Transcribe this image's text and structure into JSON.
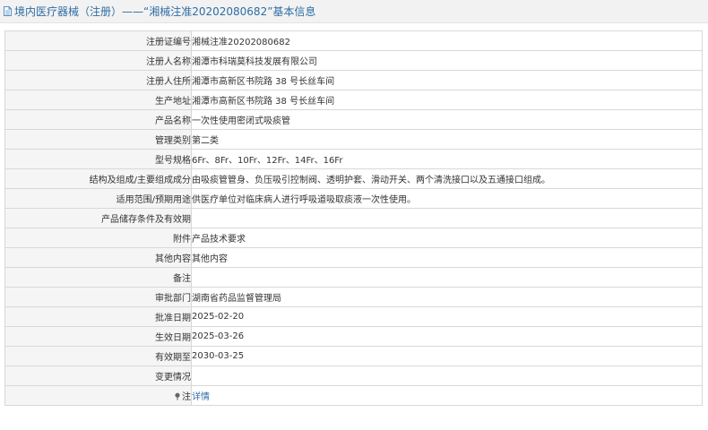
{
  "header": {
    "title": "境内医疗器械（注册）——“湘械注准20202080682”基本信息"
  },
  "rows": [
    {
      "label": "注册证编号",
      "value": "湘械注准20202080682"
    },
    {
      "label": "注册人名称",
      "value": "湘潭市科瑞莫科技发展有限公司"
    },
    {
      "label": "注册人住所",
      "value": "湘潭市高新区书院路 38 号长丝车间"
    },
    {
      "label": "生产地址",
      "value": "湘潭市高新区书院路 38 号长丝车间"
    },
    {
      "label": "产品名称",
      "value": "一次性使用密闭式吸痰管"
    },
    {
      "label": "管理类别",
      "value": "第二类"
    },
    {
      "label": "型号规格",
      "value": "6Fr、8Fr、10Fr、12Fr、14Fr、16Fr"
    },
    {
      "label": "结构及组成/主要组成成分",
      "value": "由吸痰管管身、负压吸引控制阀、透明护套、滑动开关、两个清洗接口以及五通接口组成。"
    },
    {
      "label": "适用范围/预期用途",
      "value": "供医疗单位对临床病人进行呼吸道吸取痰液一次性使用。"
    },
    {
      "label": "产品储存条件及有效期",
      "value": ""
    },
    {
      "label": "附件",
      "value": "产品技术要求"
    },
    {
      "label": "其他内容",
      "value": "其他内容"
    },
    {
      "label": "备注",
      "value": ""
    },
    {
      "label": "审批部门",
      "value": "湖南省药品监督管理局"
    },
    {
      "label": "批准日期",
      "value": "2025-02-20"
    },
    {
      "label": "生效日期",
      "value": "2025-03-26"
    },
    {
      "label": "有效期至",
      "value": "2030-03-25"
    },
    {
      "label": "变更情况",
      "value": ""
    }
  ],
  "note_row": {
    "label": "注",
    "link_text": "详情",
    "icon": "pin-icon"
  },
  "colors": {
    "title_text": "#2e6da4",
    "link": "#2e6da4",
    "label_bg": "#f5f5f5",
    "border": "#d8d8d8"
  }
}
